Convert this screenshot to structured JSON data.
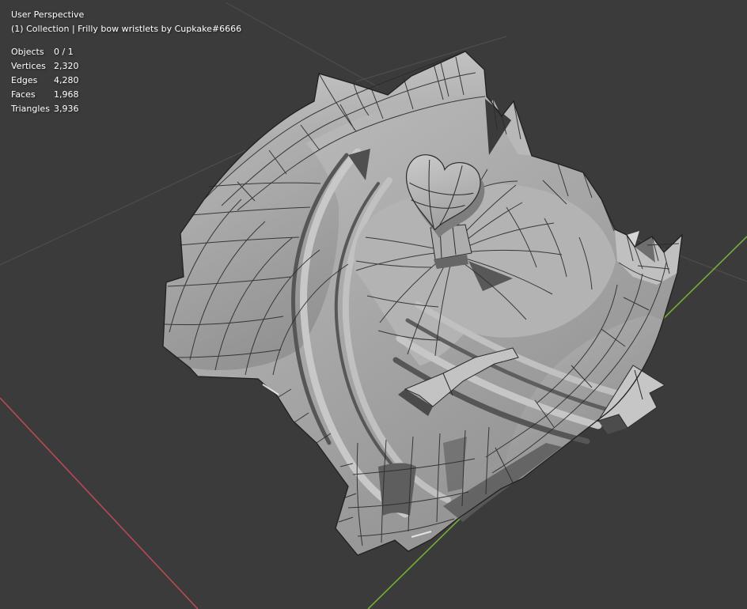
{
  "viewport": {
    "header": {
      "perspective_label": "User Perspective",
      "collection_breadcrumb": "(1) Collection | Frilly bow wristlets by Cupkake#6666"
    },
    "stats": {
      "rows": [
        {
          "label": "Objects",
          "value": "0 / 1"
        },
        {
          "label": "Vertices",
          "value": "2,320"
        },
        {
          "label": "Edges",
          "value": "4,280"
        },
        {
          "label": "Faces",
          "value": "1,968"
        },
        {
          "label": "Triangles",
          "value": "3,936"
        }
      ]
    },
    "scene": {
      "colors": {
        "background": "#3b3b3b",
        "overlay_text": "#ffffff",
        "axis_x_red": "#b84a55",
        "axis_y_green": "#78ab38",
        "grid_line": "#9a9a9a",
        "mesh_base": "#a6a6a6",
        "wireframe": "#2b2b2b"
      }
    }
  }
}
